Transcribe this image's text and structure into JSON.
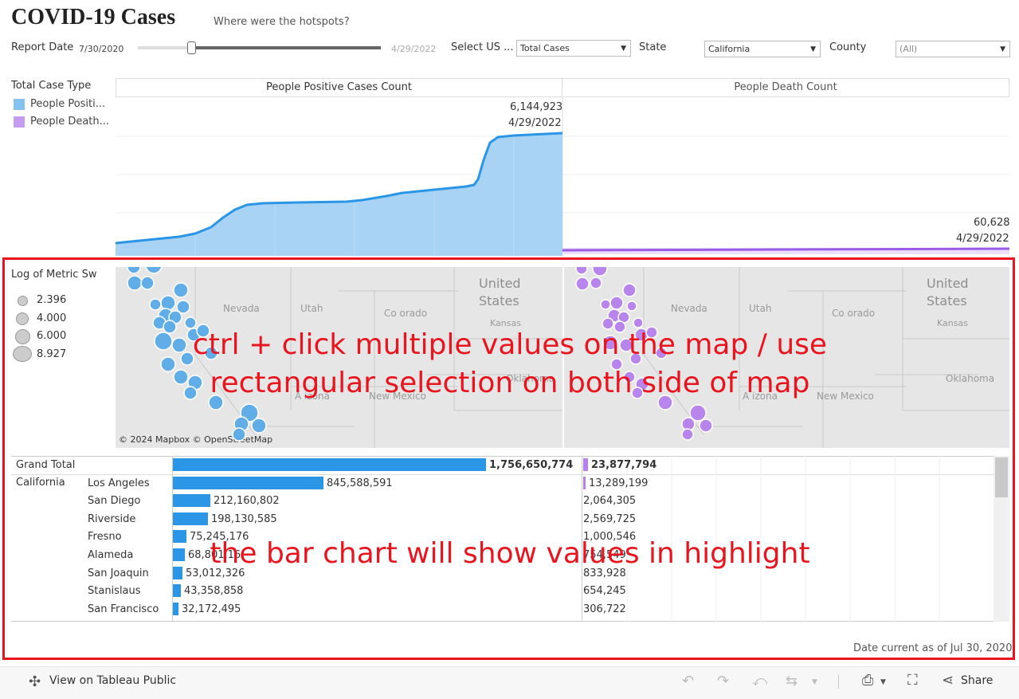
{
  "header": {
    "title": "COVID-19 Cases",
    "subtitle": "Where were the hotspots?"
  },
  "filters": {
    "report_date_label": "Report Date",
    "report_date_value": "7/30/2020",
    "report_date_end": "4/29/2022",
    "slider_position": 0.22,
    "select_us_label": "Select US ...",
    "select_us_value": "Total Cases",
    "state_label": "State",
    "state_value": "California",
    "county_label": "County",
    "county_value": "(All)"
  },
  "legend": {
    "title": "Total Case Type",
    "items": [
      {
        "label": "People Positi...",
        "color": "#85c2ef"
      },
      {
        "label": "People Death...",
        "color": "#c49cf0"
      }
    ]
  },
  "area_chart": {
    "positive_header": "People Positive Cases Count",
    "death_header": "People Death Count",
    "positive_last_value": "6,144,923",
    "positive_last_date": "4/29/2022",
    "death_last_value": "60,628",
    "death_last_date": "4/29/2022"
  },
  "size_legend": {
    "title": "Log of Metric Sw",
    "items": [
      "2.396",
      "4.000",
      "6.000",
      "8.927"
    ]
  },
  "map": {
    "left_labels": {
      "united_states": "United\nStates",
      "nevada": "Nevada",
      "utah": "Utah",
      "colorado": "Co orado",
      "kansas": "Kansas",
      "oklahoma": "Oklahoma",
      "new_mexico": "New Mexico",
      "arizona": "A izona"
    },
    "right_labels": {
      "united_states": "United\nStates",
      "nevada": "Nevada",
      "utah": "Utah",
      "colorado": "Co orado",
      "kansas": "Kansas",
      "oklahoma": "Oklahoma",
      "new_mexico": "New Mexico",
      "arizona": "A izona"
    },
    "attribution": "© 2024 Mapbox  © OpenStreetMap",
    "positive_color": "#5aaae8",
    "death_color": "#b580ec"
  },
  "table": {
    "grand_total_label": "Grand Total",
    "state": "California",
    "grand_total_cases": "1,756,650,774",
    "grand_total_deaths": "23,877,794",
    "rows": [
      {
        "county": "Los Angeles",
        "cases": "845,588,591",
        "deaths": "13,289,199",
        "case_value": 845588591,
        "death_value": 13289199
      },
      {
        "county": "San Diego",
        "cases": "212,160,802",
        "deaths": "2,064,305",
        "case_value": 212160802,
        "death_value": 2064305
      },
      {
        "county": "Riverside",
        "cases": "198,130,585",
        "deaths": "2,569,725",
        "case_value": 198130585,
        "death_value": 2569725
      },
      {
        "county": "Fresno",
        "cases": "75,245,176",
        "deaths": "1,000,546",
        "case_value": 75245176,
        "death_value": 1000546
      },
      {
        "county": "Alameda",
        "cases": "68,801,16",
        "deaths": "754,549",
        "case_value": 68801160,
        "death_value": 754549
      },
      {
        "county": "San Joaquin",
        "cases": "53,012,326",
        "deaths": "833,928",
        "case_value": 53012326,
        "death_value": 833928
      },
      {
        "county": "Stanislaus",
        "cases": "43,358,858",
        "deaths": "654,245",
        "case_value": 43358858,
        "death_value": 654245
      },
      {
        "county": "San Francisco",
        "cases": "32,172,495",
        "deaths": "306,722",
        "case_value": 32172495,
        "death_value": 306722
      }
    ],
    "grand_total_case_value": 1756650774,
    "grand_total_death_value": 23877794,
    "bar_color": "#2b95e6",
    "death_bar_color": "#b580ec"
  },
  "annotations": {
    "map_instruction_line1": "ctrl + click multiple values on the map / use",
    "map_instruction_line2": "rectangular selection on both side of map",
    "bar_instruction": "the bar chart will show values in highlight",
    "highlight_color": "#e8141e"
  },
  "date_current": "Date current as of Jul 30, 2020",
  "footer": {
    "view_on": "View on Tableau Public",
    "share": "Share"
  }
}
